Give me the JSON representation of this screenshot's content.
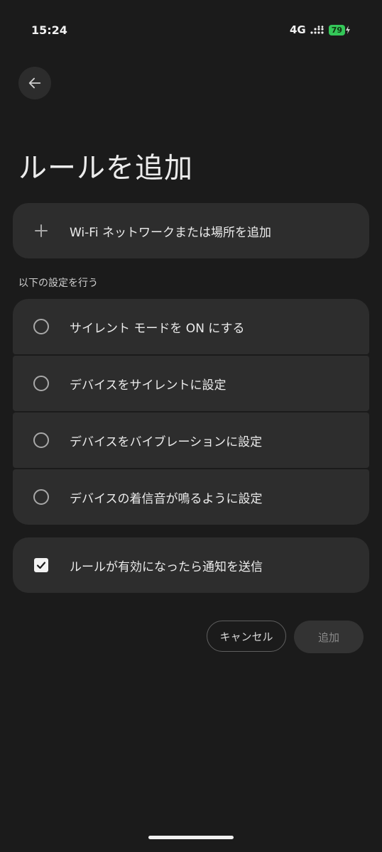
{
  "status_bar": {
    "time": "15:24",
    "network": "4G",
    "battery": "79"
  },
  "header": {
    "title": "ルールを追加"
  },
  "add_location": {
    "label": "Wi-Fi ネットワークまたは場所を追加",
    "icon": "plus-icon"
  },
  "options_section": {
    "label": "以下の設定を行う",
    "options": [
      {
        "label": "サイレント モードを ON にする",
        "selected": false
      },
      {
        "label": "デバイスをサイレントに設定",
        "selected": false
      },
      {
        "label": "デバイスをバイブレーションに設定",
        "selected": false
      },
      {
        "label": "デバイスの着信音が鳴るように設定",
        "selected": false
      }
    ]
  },
  "notify": {
    "label": "ルールが有効になったら通知を送信",
    "checked": true
  },
  "actions": {
    "cancel_label": "キャンセル",
    "add_label": "追加"
  },
  "colors": {
    "background": "#1b1b1b",
    "card": "#2d2d2d",
    "battery": "#34c759"
  }
}
